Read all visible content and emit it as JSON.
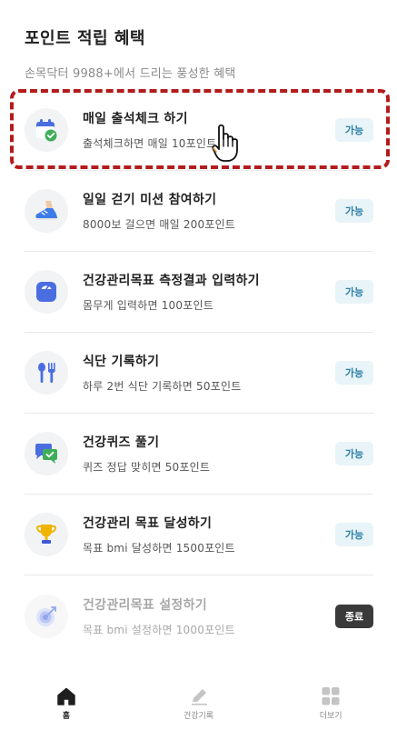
{
  "header": {
    "title": "포인트 적립 혜택",
    "subtitle": "손목닥터 9988+에서 드리는 풍성한 혜택"
  },
  "items": [
    {
      "icon": "calendar-check-icon",
      "title": "매일 출석체크 하기",
      "desc": "출석체크하면 매일 10포인트",
      "status": "가능"
    },
    {
      "icon": "sneaker-icon",
      "title": "일일 걷기 미션 참여하기",
      "desc": "8000보 걸으면 매일 200포인트",
      "status": "가능"
    },
    {
      "icon": "scale-icon",
      "title": "건강관리목표 측정결과 입력하기",
      "desc": "몸무게 입력하면 100포인트",
      "status": "가능"
    },
    {
      "icon": "fork-spoon-icon",
      "title": "식단 기록하기",
      "desc": "하루 2번 식단 기록하면 50포인트",
      "status": "가능"
    },
    {
      "icon": "quiz-chat-icon",
      "title": "건강퀴즈 풀기",
      "desc": "퀴즈 정답 맞히면 50포인트",
      "status": "가능"
    },
    {
      "icon": "trophy-icon",
      "title": "건강관리 목표 달성하기",
      "desc": "목표 bmi 달성하면 1500포인트",
      "status": "가능"
    },
    {
      "icon": "target-icon",
      "title": "건강관리목표 설정하기",
      "desc": "목표 bmi 설정하면 1000포인트",
      "status": "종료"
    }
  ],
  "nav": {
    "home": "홈",
    "health_record": "건강기록",
    "more": "더보기"
  },
  "colors": {
    "accent_blue": "#4a6ee0",
    "status_available_bg": "#e8f4f8",
    "status_done_bg": "#3a3a3a",
    "highlight": "#b31c1c"
  }
}
